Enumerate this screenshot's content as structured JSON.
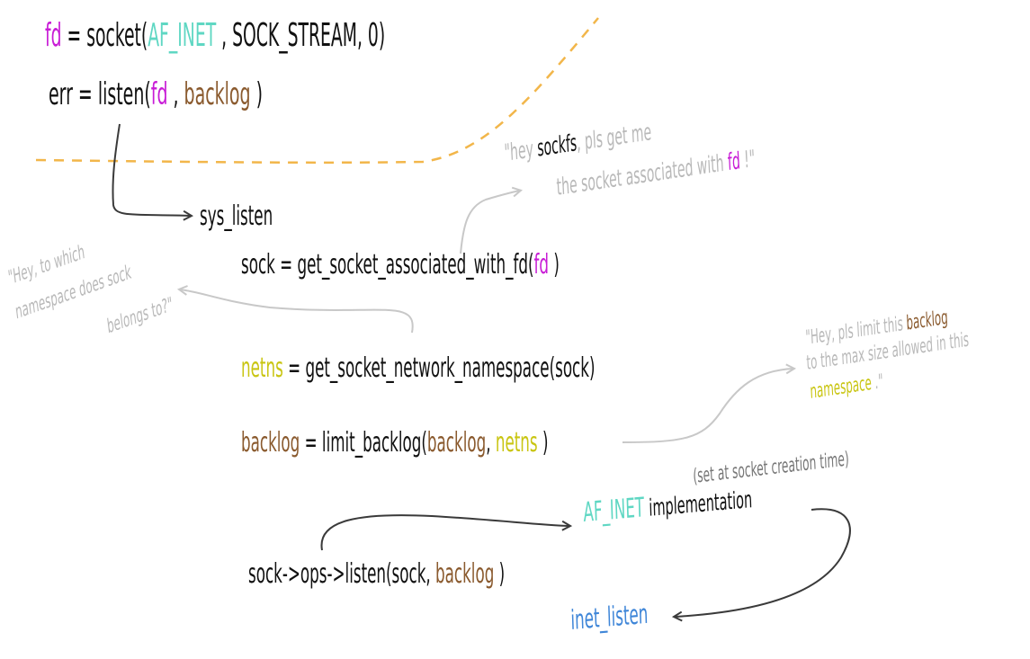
{
  "colors": {
    "fd": "#c81cd6",
    "af_inet": "#5fd7c3",
    "backlog": "#8a5a2e",
    "netns": "#c9c512",
    "inet_listen": "#3f86d8",
    "code_text": "#111111",
    "note_text": "#b9b9b9",
    "boundary_dash": "#f2b64a",
    "arrow_dark": "#3a3a3a",
    "arrow_light": "#c8c8c8"
  },
  "userspace": {
    "line1": {
      "fd": "fd",
      "assign": " = socket(",
      "af_inet": "AF_INET",
      "rest": " , SOCK_STREAM, 0)"
    },
    "line2": {
      "prefix": "err = listen(",
      "fd": "fd",
      "comma": " , ",
      "backlog": "backlog",
      "close": " )"
    }
  },
  "kernel": {
    "sys_listen": "sys_listen",
    "sock_line": {
      "prefix": "sock = get_socket_associated_with_fd(",
      "fd": "fd",
      "close": " )"
    },
    "netns_line": {
      "netns": "netns",
      "rest": " = get_socket_network_namespace(sock)"
    },
    "backlog_line": {
      "backlog": "backlog",
      "middle": " = limit_backlog(",
      "backlog_arg": "backlog",
      "comma": ", ",
      "netns": "netns",
      "close": " )"
    },
    "ops_line": {
      "prefix": "sock->ops->listen(sock, ",
      "backlog": "backlog",
      "close": " )"
    },
    "af_inet_label": "AF_INET",
    "implementation": "implementation",
    "creation_note": "(set at socket creation time)",
    "inet_listen": "inet_listen"
  },
  "notes": {
    "sockfs": {
      "pre": "\"hey ",
      "sockfs": "sockfs",
      "post": ", pls get me",
      "line2_pre": "the socket associated with ",
      "fd": "fd",
      "line2_post": " !\""
    },
    "namespace": {
      "line1": "\"Hey, to which",
      "line2": "namespace does sock",
      "line3": "belongs to?\""
    },
    "limit": {
      "line1_pre": "\"Hey, pls limit this ",
      "backlog": "backlog",
      "line2": "to the max size allowed in this",
      "namespace": "namespace",
      "tail": " .\""
    }
  }
}
